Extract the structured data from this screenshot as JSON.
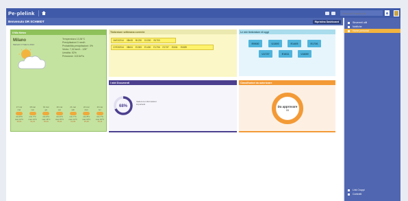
{
  "topbar": {
    "logo": "Pe◦plelink",
    "search_placeholder": "Cerca in PeopleLink"
  },
  "title": "Benvenuto DR SCHMIDT",
  "restore_label": "Ripristina Dashboard",
  "sidebar": {
    "items": [
      {
        "label": "Strumenti utili",
        "active": false
      },
      {
        "label": "Notifiche",
        "active": false
      },
      {
        "label": "Home personal",
        "active": true
      }
    ],
    "bottom_items": [
      {
        "label": "Link Cruppi"
      },
      {
        "label": "Contratti"
      }
    ]
  },
  "meteo": {
    "header": "Il Mio Meteo",
    "city": "Milano",
    "date": "Martedì 17 Marzo 2014",
    "details": [
      "Temperatura 13,36°C",
      "Precipitazioni 0 mm/h",
      "Probabilità precipitazioni: 0%",
      "Vento: 7,02 km/h - 125°",
      "Umidità: 52%",
      "Pressione: 1021hPa"
    ],
    "forecast": [
      {
        "day": "17 mar",
        "wd": "mar",
        "lo": "min 8°C",
        "hi": "max 13°C",
        "t": "13,01"
      },
      {
        "day": "18 mar",
        "wd": "mer",
        "lo": "min 7°C",
        "hi": "max 14°C",
        "t": "14,21"
      },
      {
        "day": "19 mar",
        "wd": "gio",
        "lo": "min 6°C",
        "hi": "max 15°C",
        "t": "15,01"
      },
      {
        "day": "20 mar",
        "wd": "ven",
        "lo": "min 6°C",
        "hi": "max 15°C",
        "t": "15,21"
      },
      {
        "day": "21 mar",
        "wd": "sab",
        "lo": "min 7°C",
        "hi": "max 14°C",
        "t": "14,03"
      },
      {
        "day": "22 mar",
        "wd": "dom",
        "lo": "min 8°C",
        "hi": "max 16°C",
        "t": "16,20"
      },
      {
        "day": "23 mar",
        "wd": "lun",
        "lo": "min 7°C",
        "hi": "max 15°C",
        "t": "15,11"
      }
    ]
  },
  "bench": {
    "header": "Timbrature settimana corrente",
    "rows": [
      [
        "16/03/2014",
        "08h08",
        "B1230",
        "D1330",
        "B1700"
      ],
      [
        "17/03/2014",
        "08h04",
        "E1300",
        "E1400",
        "E1706",
        "E1737",
        "E1811",
        "E1839"
      ]
    ]
  },
  "trend": {
    "header": "Le mie timbrature di oggi",
    "row1": [
      "E0930",
      "U1300",
      "E1405",
      "E1736"
    ],
    "row2": [
      "U1737",
      "E1811",
      "U1839"
    ]
  },
  "docs": {
    "header": "I miei Documenti",
    "percent": "68%",
    "label": "Vedere le informazioni importanti",
    "percent_value": 0.68
  },
  "classifier": {
    "header": "Classificatori da autorizzare",
    "title": "Da approvare",
    "count": "55"
  },
  "colors": {
    "primary": "#3f5aa8",
    "sidebar": "#5066b0",
    "meteo": "#8ec15a",
    "docs": "#4b3f8e",
    "class": "#f39a36",
    "active": "#f3b43f"
  }
}
